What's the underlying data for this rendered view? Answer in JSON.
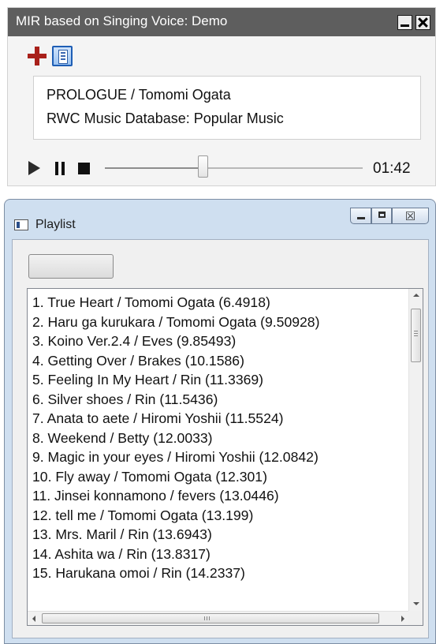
{
  "player": {
    "title": "MIR based on Singing Voice: Demo",
    "titlebar_buttons": [
      "minimize-icon",
      "close-icon"
    ],
    "toolbar_icons": [
      "add-icon",
      "document-icon"
    ],
    "info": {
      "song": "PROLOGUE / Tomomi Ogata",
      "database": "RWC Music Database: Popular Music"
    },
    "controls": [
      "play-icon",
      "pause-icon",
      "stop-icon"
    ],
    "seek_position_fraction": 0.38,
    "time": "01:42",
    "accent_colors": {
      "add_icon": "#a8201a",
      "titlebar": "#5e5e5e"
    }
  },
  "playlist": {
    "title": "Playlist",
    "caption_buttons": [
      "minimize-icon",
      "maximize-icon",
      "close-icon"
    ],
    "close_glyph": "☒",
    "button_label": "",
    "items": [
      "1. True Heart / Tomomi Ogata (6.4918)",
      "2. Haru ga kurukara / Tomomi Ogata (9.50928)",
      "3. Koino Ver.2.4 / Eves (9.85493)",
      "4. Getting Over / Brakes (10.1586)",
      "5. Feeling In My Heart / Rin (11.3369)",
      "6. Silver shoes / Rin (11.5436)",
      "7. Anata to aete / Hiromi Yoshii (11.5524)",
      "8. Weekend / Betty (12.0033)",
      "9. Magic in your eyes / Hiromi Yoshii (12.0842)",
      "10. Fly away / Tomomi Ogata (12.301)",
      "11. Jinsei konnamono / fevers (13.0446)",
      "12. tell me / Tomomi Ogata (13.199)",
      "13. Mrs. Maril / Rin (13.6943)",
      "14. Ashita wa / Rin (13.8317)",
      "15. Harukana omoi / Rin (14.2337)"
    ],
    "vertical_scroll_fraction": 0.0,
    "horizontal_scroll_fraction": 0.0
  }
}
